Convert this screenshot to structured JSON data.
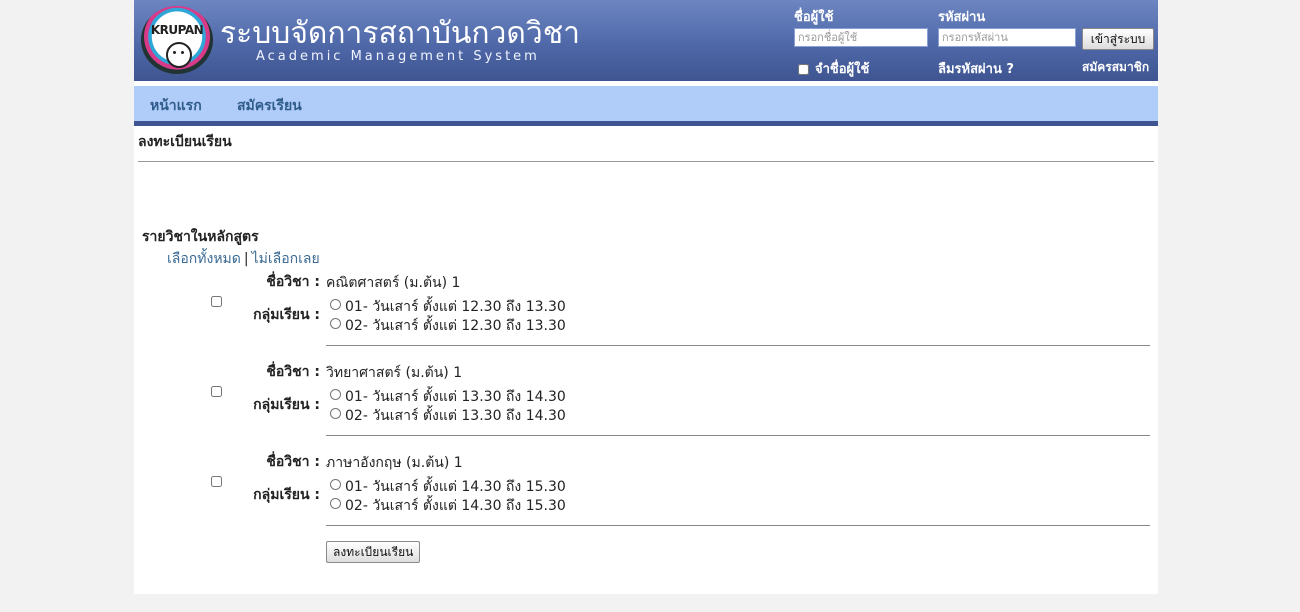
{
  "header": {
    "logo_text": "KRUPAN",
    "title": "ระบบจัดการสถาบันกวดวิชา",
    "subtitle": "Academic Management System"
  },
  "login": {
    "username_label": "ชื่อผู้ใช้",
    "username_placeholder": "กรอกชื่อผู้ใช้",
    "password_label": "รหัสผ่าน",
    "password_placeholder": "กรอกรหัสผ่าน",
    "submit_label": "เข้าสู่ระบบ",
    "remember_label": "จำชื่อผู้ใช้",
    "forgot_label": "ลืมรหัสผ่าน ?",
    "register_label": "สมัครสมาชิก"
  },
  "nav": {
    "items": [
      "หน้าแรก",
      "สมัครเรียน"
    ]
  },
  "page": {
    "heading": "ลงทะเบียนเรียน",
    "curriculum_heading": "รายวิชาในหลักสูตร",
    "select_all": "เลือกทั้งหมด",
    "separator": "|",
    "select_none": "ไม่เลือกเลย",
    "course_label": "ชื่อวิชา :",
    "group_label": "กลุ่มเรียน :",
    "submit_label": "ลงทะเบียนเรียน"
  },
  "courses": [
    {
      "name": "คณิตศาสตร์ (ม.ต้น) 1",
      "checked": false,
      "groups": [
        "01- วันเสาร์  ตั้งแต่ 12.30 ถึง 13.30",
        "02- วันเสาร์  ตั้งแต่ 12.30 ถึง 13.30"
      ]
    },
    {
      "name": "วิทยาศาสตร์ (ม.ต้น) 1",
      "checked": false,
      "groups": [
        "01- วันเสาร์  ตั้งแต่ 13.30 ถึง 14.30",
        "02- วันเสาร์  ตั้งแต่ 13.30 ถึง 14.30"
      ]
    },
    {
      "name": "ภาษาอังกฤษ (ม.ต้น) 1",
      "checked": false,
      "groups": [
        "01- วันเสาร์  ตั้งแต่ 14.30 ถึง 15.30",
        "02- วันเสาร์  ตั้งแต่ 14.30 ถึง 15.30"
      ]
    }
  ]
}
